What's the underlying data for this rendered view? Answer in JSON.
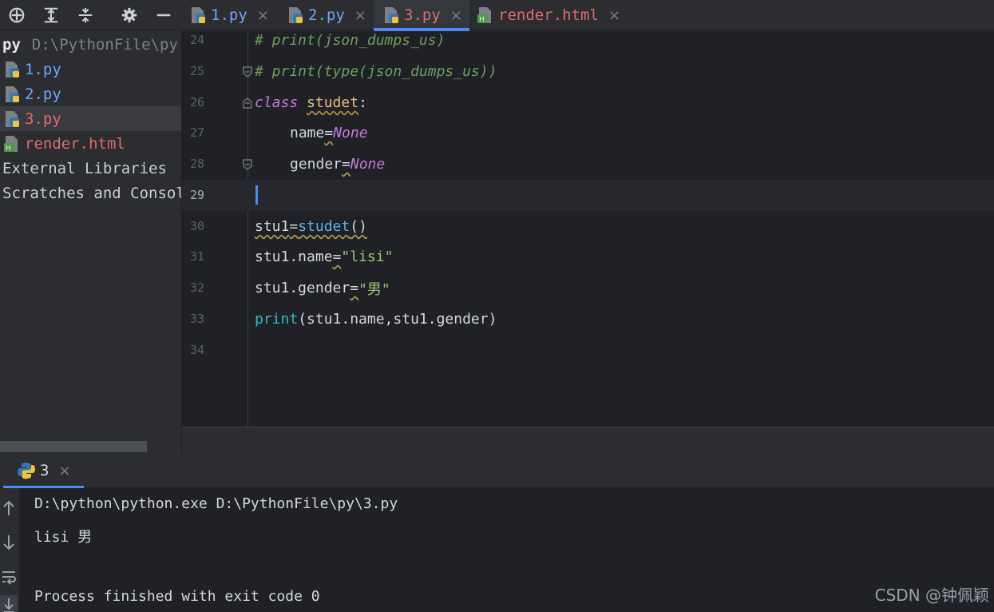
{
  "toolbar": {
    "icons": [
      "crosshair-icon",
      "expand-all-icon",
      "collapse-all-icon",
      "gear-icon",
      "minimize-icon"
    ]
  },
  "tabs": [
    {
      "label": "1.py",
      "type": "python"
    },
    {
      "label": "2.py",
      "type": "python"
    },
    {
      "label": "3.py",
      "type": "python",
      "active": true
    },
    {
      "label": "render.html",
      "type": "html"
    }
  ],
  "sidebar": {
    "root_name": "py",
    "root_path": "D:\\PythonFile\\py",
    "items": [
      {
        "label": "1.py"
      },
      {
        "label": "2.py"
      },
      {
        "label": "3.py",
        "selected": true
      },
      {
        "label": "render.html"
      },
      {
        "label": "External Libraries"
      },
      {
        "label": "Scratches and Consoles"
      }
    ]
  },
  "editor": {
    "lines": [
      {
        "no": "24",
        "text": "# print(json_dumps_us)"
      },
      {
        "no": "25",
        "text": "# print(type(json_dumps_us))"
      },
      {
        "no": "26",
        "kw": "class",
        "name": "studet",
        "colon": ":"
      },
      {
        "no": "27",
        "attr": "name",
        "op": "=",
        "value": "None"
      },
      {
        "no": "28",
        "attr": "gender",
        "op": "=",
        "value": "None"
      },
      {
        "no": "29",
        "current": true
      },
      {
        "no": "30",
        "var": "stu1",
        "op": "=",
        "call": "studet",
        "paren": "()"
      },
      {
        "no": "31",
        "target": "stu1.name",
        "op": "=",
        "str": "\"lisi\""
      },
      {
        "no": "32",
        "target": "stu1.gender",
        "op": "=",
        "str": "\"男\""
      },
      {
        "no": "33",
        "fn": "print",
        "args": "(stu1.name,stu1.gender)"
      },
      {
        "no": "34"
      }
    ]
  },
  "run_panel": {
    "tab_label": "3",
    "console_lines": [
      "D:\\python\\python.exe D:\\PythonFile\\py\\3.py",
      "lisi 男",
      "",
      "Process finished with exit code 0"
    ]
  },
  "watermark": "CSDN @钟佩颖",
  "colors": {
    "accent": "#4c8bf5",
    "keyword": "#c679dd",
    "string": "#98c379",
    "comment": "#6f9e5c",
    "modified_file": "#e06c6c",
    "python_file": "#6ea7ff"
  }
}
